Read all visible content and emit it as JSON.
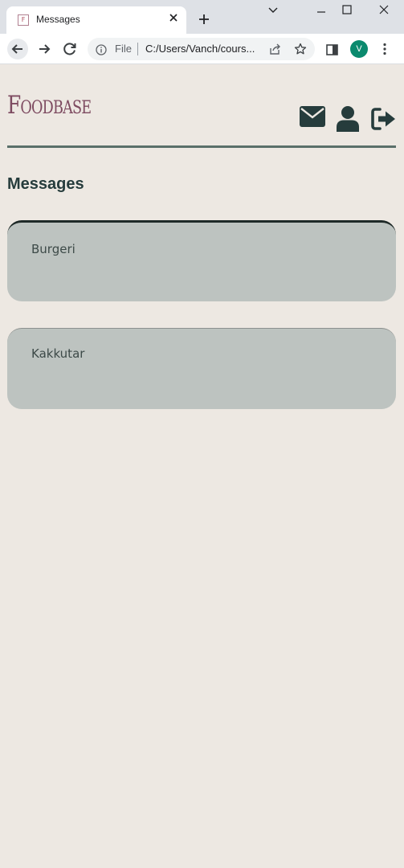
{
  "browser": {
    "tab_title": "Messages",
    "tab_favicon_letter": "F",
    "file_label": "File",
    "url": "C:/Users/Vanch/cours...",
    "profile_initial": "V"
  },
  "app": {
    "logo": "Foodbase",
    "page_title": "Messages",
    "messages": [
      {
        "label": "Burgeri"
      },
      {
        "label": "Kakkutar"
      }
    ]
  },
  "colors": {
    "background": "#ede8e2",
    "accent": "#263c3c",
    "logo": "#7d4a60",
    "card": "#bdc3c0",
    "profile": "#0b8a6e"
  }
}
